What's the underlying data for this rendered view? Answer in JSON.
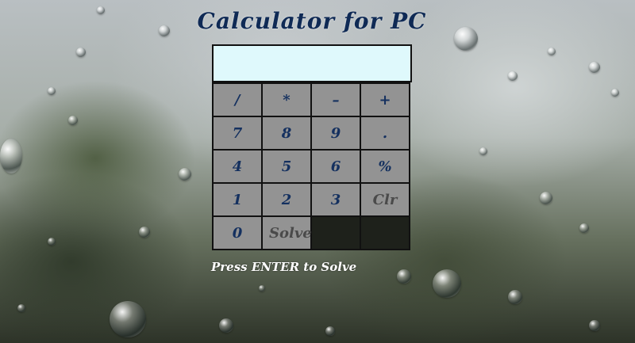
{
  "app": {
    "title": "Calculator for PC"
  },
  "display": {
    "value": ""
  },
  "keys": {
    "divide": "/",
    "multiply": "*",
    "minus": "–",
    "plus": "+",
    "seven": "7",
    "eight": "8",
    "nine": "9",
    "dot": ".",
    "four": "4",
    "five": "5",
    "six": "6",
    "percent": "%",
    "one": "1",
    "two": "2",
    "three": "3",
    "clear": "Clr",
    "zero": "0",
    "solve": "Solve"
  },
  "hint": "Press ENTER to Solve",
  "colors": {
    "title": "#0f2a55",
    "display_bg": "#dff9fc",
    "key_text": "#14305f"
  }
}
